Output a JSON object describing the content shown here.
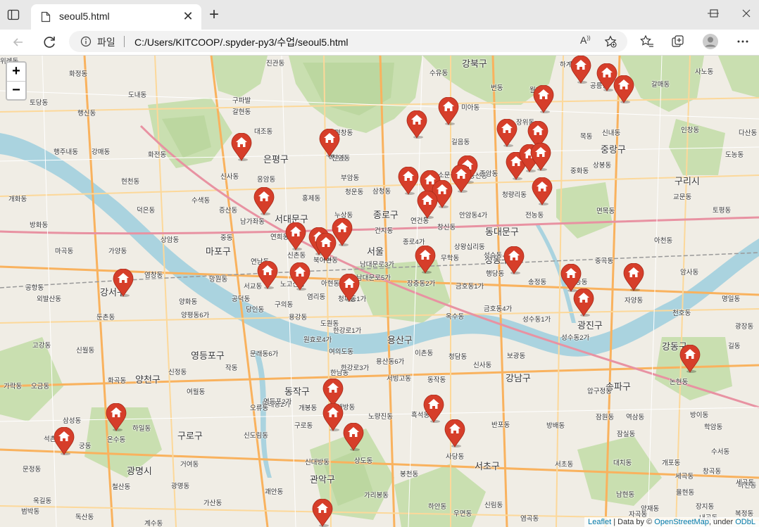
{
  "browser": {
    "tab_title": "seoul5.html",
    "scheme_label": "파일",
    "url": "C:/Users/KITCOOP/.spyder-py3/수업/seoul5.html",
    "read_aloud": "A"
  },
  "map": {
    "zoom_in": "+",
    "zoom_out": "−",
    "attribution": {
      "leaflet": "Leaflet",
      "data_by": " | Data by © ",
      "osm": "OpenStreetMap",
      "under": ", under ",
      "odbl": "ODbL"
    },
    "marker_color": "#d63e2a",
    "marker_count": 45,
    "district_labels": [
      "강북구",
      "은평구",
      "중랑구",
      "구리시",
      "서대문구",
      "종로구",
      "동대문구",
      "마포구",
      "서울",
      "성동구",
      "강서구",
      "광진구",
      "용산구",
      "영등포구",
      "강동구",
      "양천구",
      "강남구",
      "동작구",
      "송파구",
      "구로구",
      "광명시",
      "서초구",
      "관악구"
    ],
    "place_labels": [
      "진관동",
      "수유동",
      "하계동",
      "공릉동",
      "사노동",
      "화정동",
      "번동",
      "월계동",
      "갈매동",
      "도내동",
      "구파발",
      "갈현동",
      "미아동",
      "장위동",
      "토당동",
      "대조동",
      "평창동",
      "신내동",
      "행신동",
      "인창동",
      "다산동",
      "행주내동",
      "강매동",
      "역촌동",
      "신영동",
      "길음동",
      "목동",
      "화전동",
      "도농동",
      "현천동",
      "신사동",
      "응암동",
      "부암동",
      "동선동",
      "종암동",
      "상봉동",
      "중화동",
      "개화동",
      "수색동",
      "홍제동",
      "청운동",
      "삼청동",
      "소문동",
      "청량리동",
      "교문동",
      "토평동",
      "덕은동",
      "증산동",
      "누상동",
      "안암동4가",
      "전농동",
      "방화동",
      "남가좌동",
      "면목동",
      "상암동",
      "연희동",
      "중동",
      "신촌동",
      "건지동",
      "연건동",
      "창신동",
      "아천동",
      "마곡동",
      "가양동",
      "망원동",
      "연남동",
      "북아현동",
      "종로4가",
      "상왕십리동",
      "성수동",
      "중곡동",
      "공항동",
      "외발산동",
      "염창동",
      "서교동",
      "노고산동",
      "남대문로3가",
      "무학동",
      "행당동",
      "송정동",
      "능동",
      "암사동",
      "공덕동",
      "아현동",
      "남대문로5가",
      "장충동2가",
      "금호동1가",
      "구의동",
      "명일동",
      "양화동",
      "용강동",
      "염리동",
      "청파동1가",
      "천호동",
      "고강동",
      "신월동",
      "양평동6가",
      "당인동",
      "도원동",
      "원효로4가",
      "한강로1가",
      "용산동6가",
      "서빙고동",
      "한남동",
      "옥수동",
      "금호동4가",
      "성수동1가",
      "성수동2가",
      "자양동",
      "광장동",
      "길동",
      "둔촌동",
      "화곡동",
      "신정동",
      "문래동6가",
      "여의도동",
      "한강로3가",
      "이촌동",
      "보광동",
      "청담동",
      "신사동",
      "압구정동",
      "논현동",
      "잠실동",
      "방이동",
      "가락동",
      "오금동",
      "여월동",
      "작동",
      "문래동2가",
      "영등포2가",
      "대방동",
      "노량진동",
      "흑석동",
      "동작동",
      "반포동",
      "잠원동",
      "역삼동",
      "삼성동",
      "석촌동",
      "궁동",
      "온수동",
      "오류동",
      "개봉동",
      "신도림동",
      "구로동",
      "신대방동",
      "상도동",
      "봉천동",
      "사당동",
      "방배동",
      "서초동",
      "대치동",
      "개포동",
      "수서동",
      "문정동",
      "거여동",
      "괘안동",
      "가리봉동",
      "신림동",
      "남현동",
      "양재동",
      "자곡동",
      "세곡동",
      "율현동",
      "장지동",
      "마천동",
      "하일동",
      "철산동",
      "광명동",
      "가산동",
      "독산동",
      "옥길동",
      "범박동",
      "계수동",
      "하안동",
      "우면동",
      "염곡동",
      "내곡동",
      "세곡동",
      "복정동",
      "학암동",
      "창곡동",
      "위례동"
    ]
  }
}
